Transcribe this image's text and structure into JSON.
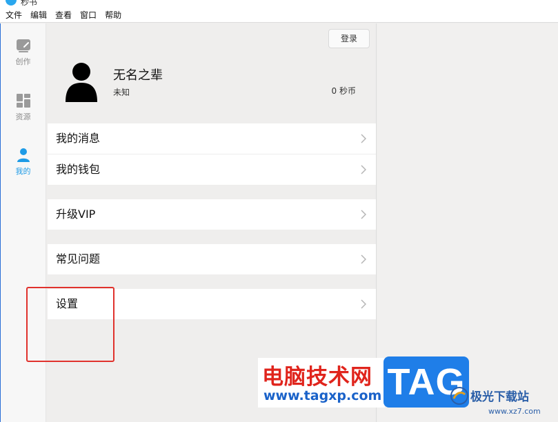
{
  "window": {
    "title": "秒书"
  },
  "menubar": {
    "items": [
      "文件",
      "编辑",
      "查看",
      "窗口",
      "帮助"
    ]
  },
  "nav": {
    "items": [
      {
        "label": "创作",
        "icon": "compose-icon",
        "active": false
      },
      {
        "label": "资源",
        "icon": "grid-icon",
        "active": false
      },
      {
        "label": "我的",
        "icon": "user-icon",
        "active": true
      }
    ],
    "active_color": "#1e9be6"
  },
  "profile": {
    "login_label": "登录",
    "username": "无名之辈",
    "gender": "未知",
    "coins": "0 秒币",
    "avatar_icon": "user-avatar-icon"
  },
  "menu": {
    "messages": "我的消息",
    "wallet": "我的钱包",
    "vip": "升级VIP",
    "faq": "常见问题",
    "settings": "设置"
  },
  "annotation": {
    "color": "#e0312c"
  },
  "watermark": {
    "cn_text": "电脑技术网",
    "url": "www.tagxp.com",
    "tag": "TAG",
    "brand": "极光下载站",
    "site": "www.xz7.com"
  }
}
